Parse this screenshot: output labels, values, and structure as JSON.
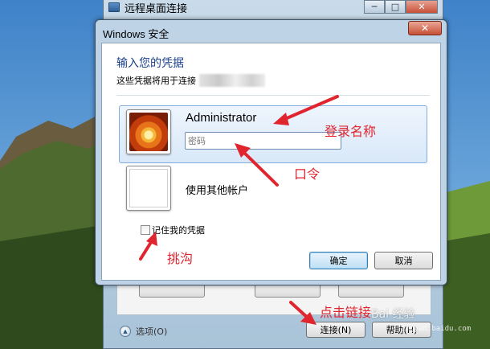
{
  "rdp_window": {
    "title": "远程桌面连接",
    "controls": [
      "─",
      "□",
      "✕"
    ],
    "options_label": "选项(O)",
    "connect_label": "连接(N)",
    "help_label": "帮助(H)"
  },
  "dialog": {
    "title": "Windows 安全",
    "close_glyph": "✕",
    "heading": "输入您的凭据",
    "subtitle": "这些凭据将用于连接",
    "account_name": "Administrator",
    "password_placeholder": "密码",
    "other_account": "使用其他帐户",
    "remember_label": "记住我的凭据",
    "ok_label": "确定",
    "cancel_label": "取消"
  },
  "annotations": {
    "login_name": "登录名称",
    "password": "口令",
    "check": "挑沟",
    "click_connect": "点击链接"
  },
  "watermark": {
    "text": "Bai 经验",
    "url": "jingyan.baidu.com"
  },
  "colors": {
    "annotation_red": "#e0252f",
    "heading_blue": "#1a3f8a",
    "selected_tile": "#d9e8f8"
  }
}
